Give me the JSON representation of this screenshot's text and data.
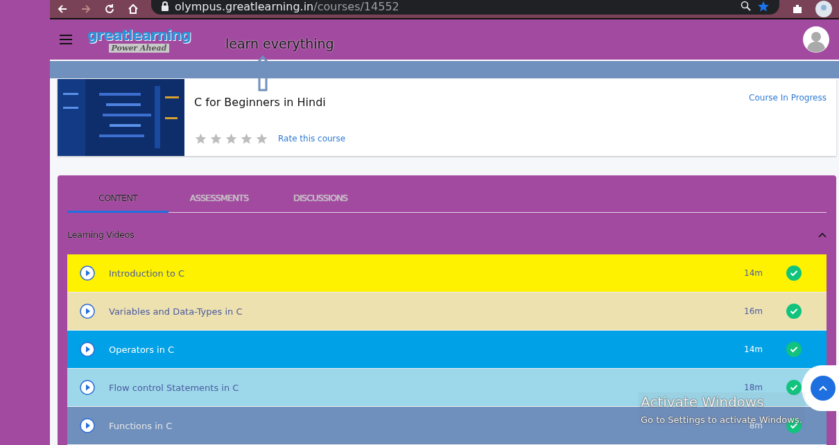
{
  "browser": {
    "url_host": "olympus.greatlearning.in",
    "url_path": "/courses/14552"
  },
  "header": {
    "logo": {
      "name": "greatlearning",
      "tagline": "Power Ahead"
    },
    "slogan": "learn everything"
  },
  "course": {
    "title": "C for Beginners in Hindi",
    "stars": 0,
    "rate_link": "Rate this course",
    "status": "Course In Progress"
  },
  "tabs": [
    {
      "label": "CONTENT",
      "selected": true
    },
    {
      "label": "ASSESSMENTS",
      "selected": false
    },
    {
      "label": "DISCUSSIONS",
      "selected": false
    }
  ],
  "section": {
    "title": "Learning Videos",
    "expanded": true
  },
  "videos": [
    {
      "title": "Introduction to C",
      "duration": "14m",
      "completed": true,
      "color": "#fff200"
    },
    {
      "title": "Variables and Data-Types in C",
      "duration": "16m",
      "completed": true,
      "color": "#eee1b0"
    },
    {
      "title": "Operators in C",
      "duration": "14m",
      "completed": true,
      "color": "#00a1e6"
    },
    {
      "title": "Flow control Statements in C",
      "duration": "18m",
      "completed": true,
      "color": "#9dd8ea"
    },
    {
      "title": "Functions in C",
      "duration": "8m",
      "completed": true,
      "color": "#6f90bd"
    }
  ],
  "os_notice": {
    "title": "Activate Windows",
    "text": "Go to Settings to activate Windows."
  }
}
